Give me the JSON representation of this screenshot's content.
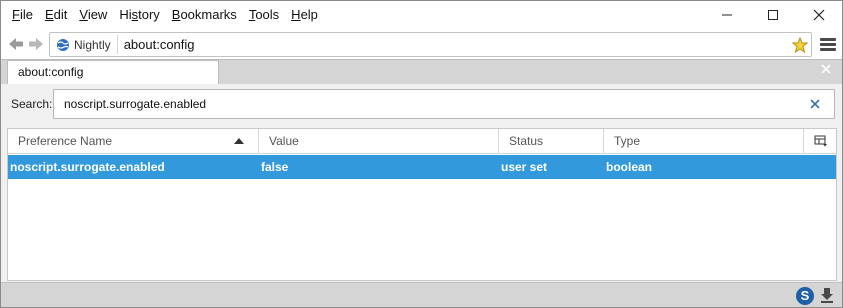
{
  "menubar": {
    "items": [
      {
        "first": "F",
        "rest": "ile"
      },
      {
        "first": "E",
        "rest": "dit"
      },
      {
        "first": "V",
        "rest": "iew"
      },
      {
        "pre": "Hi",
        "first": "s",
        "rest": "tory"
      },
      {
        "first": "B",
        "rest": "ookmarks"
      },
      {
        "first": "T",
        "rest": "ools"
      },
      {
        "first": "H",
        "rest": "elp"
      }
    ]
  },
  "navbar": {
    "identity_label": "Nightly",
    "url": "about:config"
  },
  "tabs": [
    {
      "label": "about:config"
    }
  ],
  "search": {
    "label": "Search:",
    "value": "noscript.surrogate.enabled"
  },
  "table": {
    "columns": [
      "Preference Name",
      "Value",
      "Status",
      "Type"
    ],
    "rows": [
      {
        "name": "noscript.surrogate.enabled",
        "value": "false",
        "status": "user set",
        "type": "boolean"
      }
    ]
  },
  "statusbar": {
    "s_icon_letter": "S"
  },
  "colors": {
    "selection": "#3399dd",
    "chrome": "#d5d5d5",
    "content_bg": "#f0f0f0"
  },
  "icons": [
    "back-icon",
    "forward-icon",
    "globe-icon",
    "star-icon",
    "menu-icon",
    "close-tab-icon",
    "clear-search-icon",
    "sort-ascending-icon",
    "column-picker-icon",
    "download-icon"
  ]
}
